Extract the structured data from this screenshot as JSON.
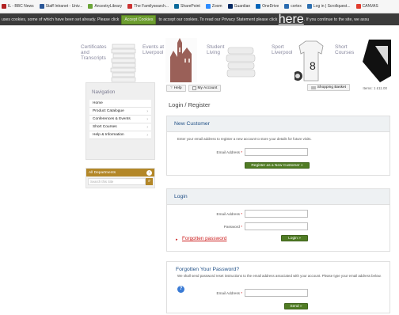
{
  "bookmarks": [
    {
      "label": "IL - BBC News",
      "color": "#b22222"
    },
    {
      "label": "Staff Intranet - Univ...",
      "color": "#2b5797"
    },
    {
      "label": "AncestryLibrary",
      "color": "#6ba539"
    },
    {
      "label": "The Familysearch...",
      "color": "#cc3333"
    },
    {
      "label": "SharePoint",
      "color": "#0b6a9a"
    },
    {
      "label": "Zoom",
      "color": "#2d8cff"
    },
    {
      "label": "Guardian",
      "color": "#052962"
    },
    {
      "label": "OneDrive",
      "color": "#0364b8"
    },
    {
      "label": "cortex",
      "color": "#2b6cb0"
    },
    {
      "label": "Log in | Scrollquest...",
      "color": "#2d6fb0"
    },
    {
      "label": "CANVAS",
      "color": "#e13c2e"
    }
  ],
  "cookie": {
    "text_before": "uses cookies, some of which have been set already. Please click",
    "button": "Accept Cookies",
    "text_middle": "to accept our cookies. To read our Privacy Statement please click",
    "link": "here",
    "text_after": ". If you continue to the site, we assu"
  },
  "banner": {
    "items": [
      {
        "lines": [
          "Certificates",
          "and",
          "Transcripts"
        ]
      },
      {
        "lines": [
          "Events at",
          "Liverpool"
        ]
      },
      {
        "lines": [
          "Student",
          "Living"
        ]
      },
      {
        "lines": [
          "Sport",
          "Liverpool"
        ]
      },
      {
        "lines": [
          "Short",
          "Courses"
        ]
      }
    ]
  },
  "nav": {
    "title": "Navigation",
    "items": [
      {
        "label": "Home"
      },
      {
        "label": "Product Catalogue"
      },
      {
        "label": "Conferences & Events"
      },
      {
        "label": "Short Courses"
      },
      {
        "label": "Help & Information"
      }
    ]
  },
  "departments": {
    "title": "All Departments",
    "search_placeholder": "Search this Site"
  },
  "toolbar": {
    "help": "Help",
    "account": "My Account",
    "basket": "Shopping Basket",
    "items_summary": "Items: 1 £11.00"
  },
  "page": {
    "title": "Login / Register"
  },
  "new_customer": {
    "heading": "New Customer",
    "text": "Enter your email address to register a new account to store your details for future visits.",
    "email_label": "Email Address",
    "button": "Register as a New Customer »"
  },
  "login": {
    "heading": "Login",
    "email_label": "Email Address",
    "password_label": "Password",
    "forgotten": "Forgotten password",
    "button": "Login »"
  },
  "forgot": {
    "heading": "Forgotten Your Password?",
    "text": "We shall send password reset instructions to the email address associated with your account. Please type your email address below.",
    "email_label": "Email Address",
    "button": "Send »"
  }
}
